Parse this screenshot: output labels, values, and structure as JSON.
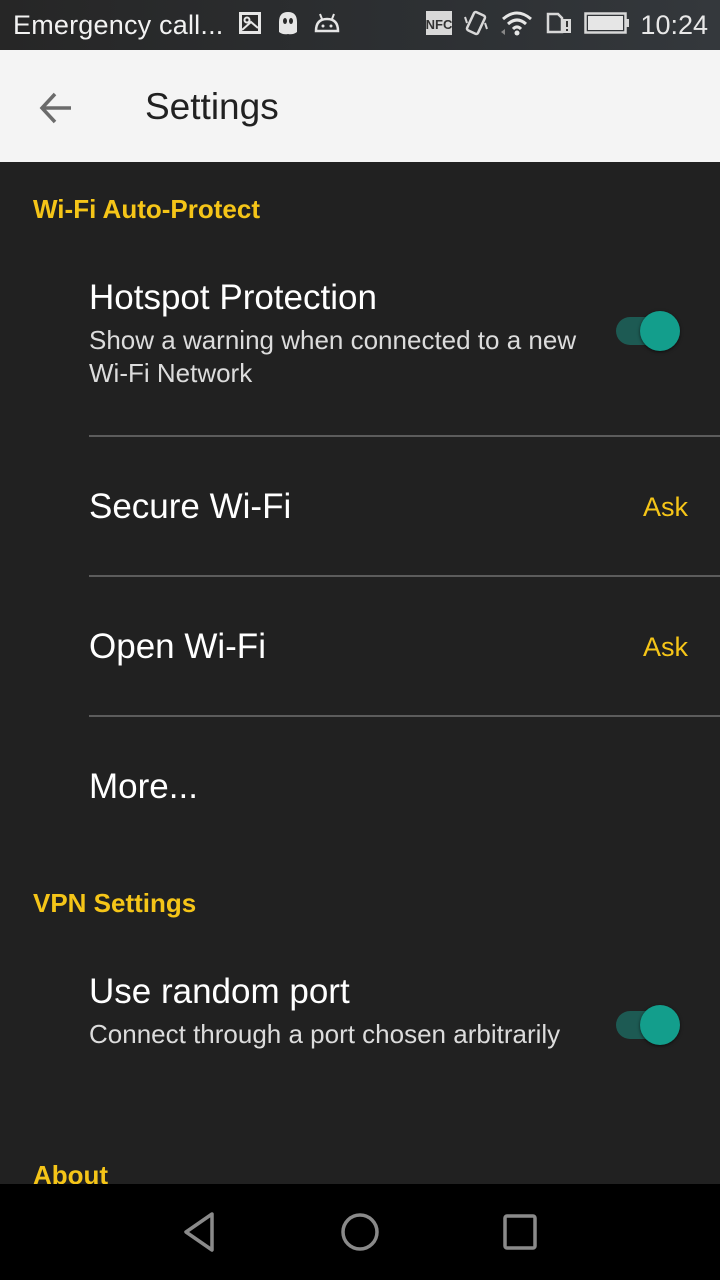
{
  "status_bar": {
    "carrier_text": "Emergency call...",
    "left_icons": [
      "image-icon",
      "ghost-icon",
      "android-icon"
    ],
    "right_icons": [
      "nfc-icon",
      "vibrate-icon",
      "wifi-icon",
      "sim-alert-icon",
      "battery-icon"
    ],
    "nfc_label": "NFC",
    "time": "10:24"
  },
  "app_bar": {
    "back_icon": "arrow-left-icon",
    "title": "Settings"
  },
  "sections": [
    {
      "header": "Wi-Fi Auto-Protect",
      "items": [
        {
          "title": "Hotspot Protection",
          "summary": "Show a warning when connected to a new Wi-Fi Network",
          "control": "switch",
          "checked": true
        },
        {
          "title": "Secure Wi-Fi",
          "value": "Ask"
        },
        {
          "title": "Open Wi-Fi",
          "value": "Ask"
        },
        {
          "title": "More..."
        }
      ]
    },
    {
      "header": "VPN Settings",
      "items": [
        {
          "title": "Use random port",
          "summary": "Connect through a port chosen arbitrarily",
          "control": "switch",
          "checked": true
        }
      ]
    },
    {
      "header": "About",
      "items": []
    }
  ],
  "nav_bar": {
    "buttons": [
      "back-triangle-icon",
      "home-circle-icon",
      "recents-square-icon"
    ]
  },
  "colors": {
    "accent": "#f5c518",
    "switch_on": "#139e8c",
    "background": "#212121",
    "app_bar": "#f4f4f4"
  }
}
